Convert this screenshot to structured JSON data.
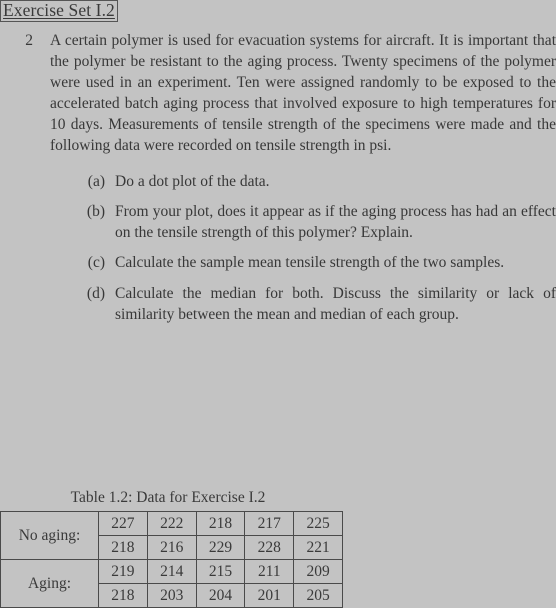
{
  "heading": {
    "title": "Exercise Set I.2",
    "boxed": true,
    "underlined": true
  },
  "problem": {
    "number": "2",
    "text": "A certain polymer is used for evacuation systems for aircraft. It is important that the polymer be resistant to the aging process. Twenty specimens of the polymer were used in an experiment. Ten were assigned randomly to be exposed to the accelerated batch aging process that involved exposure to high temperatures for 10 days. Measurements of tensile strength of the specimens were made and the following data were recorded on tensile strength in psi.",
    "subitems": [
      {
        "label": "(a)",
        "text": "Do a dot plot of the data."
      },
      {
        "label": "(b)",
        "text": "From your plot, does it appear as if the aging process has had an effect on the tensile strength of this polymer? Explain."
      },
      {
        "label": "(c)",
        "text": "Calculate the sample mean tensile strength of the two samples."
      },
      {
        "label": "(d)",
        "text": "Calculate the median for both. Discuss the similarity or lack of similarity between the mean and median of each group."
      }
    ]
  },
  "table": {
    "caption": "Table 1.2: Data for Exercise I.2",
    "groups": [
      {
        "label": "No aging:",
        "rows": [
          [
            "227",
            "222",
            "218",
            "217",
            "225"
          ],
          [
            "218",
            "216",
            "229",
            "228",
            "221"
          ]
        ]
      },
      {
        "label": "Aging:",
        "rows": [
          [
            "219",
            "214",
            "215",
            "211",
            "209"
          ],
          [
            "218",
            "203",
            "204",
            "201",
            "205"
          ]
        ]
      }
    ]
  },
  "colors": {
    "page_background": "#c3c3c3",
    "text": "#3a3a3a",
    "rule": "#4a4a4a"
  }
}
